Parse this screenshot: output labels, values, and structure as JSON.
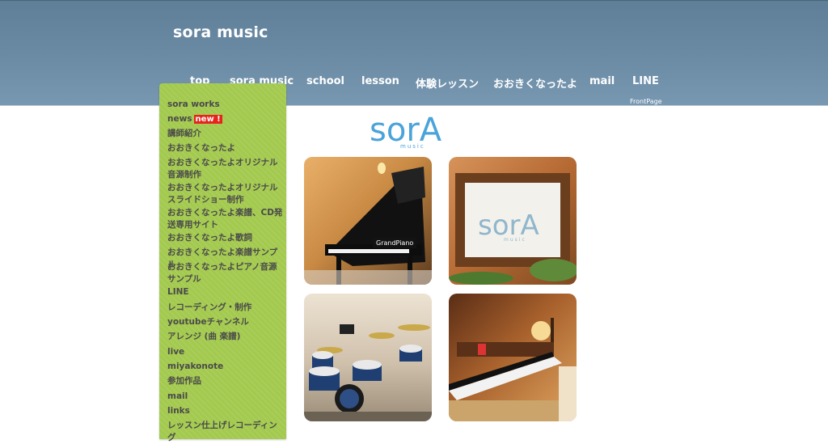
{
  "site": {
    "title": "sora music"
  },
  "nav": {
    "items": [
      {
        "label": "top"
      },
      {
        "label": "sora music"
      },
      {
        "label": "school"
      },
      {
        "label": "lesson"
      },
      {
        "label": "体験レッスン"
      },
      {
        "label": "おおきくなったよ"
      },
      {
        "label": "mail"
      },
      {
        "label": "LINE"
      }
    ],
    "sub_label": "FrontPage"
  },
  "sidebar": {
    "items": [
      {
        "label": "sora works"
      },
      {
        "label": "news"
      },
      {
        "label": "講師紹介"
      },
      {
        "label": "おおきくなったよ"
      },
      {
        "label": "おおきくなったよオリジナル音源制作"
      },
      {
        "label": "おおきくなったよオリジナルスライドショー制作"
      },
      {
        "label": "おおきくなったよ楽譜、CD発送専用サイト"
      },
      {
        "label": "おおきくなったよ歌詞"
      },
      {
        "label": "おおきくなったよ楽譜サンプル"
      },
      {
        "label": "おおきくなったよピアノ音源サンプル"
      },
      {
        "label": "LINE"
      },
      {
        "label": "レコーディング・制作"
      },
      {
        "label": "youtubeチャンネル"
      },
      {
        "label": "アレンジ (曲 楽譜)"
      },
      {
        "label": "live"
      },
      {
        "label": "miyakonote"
      },
      {
        "label": "参加作品"
      },
      {
        "label": "mail"
      },
      {
        "label": "links"
      },
      {
        "label": "レッスン仕上げレコーディング"
      }
    ],
    "new_badge": "new !"
  },
  "logo": {
    "text": "sorA",
    "sub": "music",
    "color": "#4aa3d9"
  },
  "gallery": {
    "photos": [
      {
        "caption": "GrandPiano"
      },
      {
        "logo_text": "sorA",
        "logo_sub": "music"
      },
      {},
      {}
    ]
  },
  "colors": {
    "header": "#6a8aa4",
    "sidebar": "#a3c94e",
    "badge": "#e8231d",
    "logo": "#4aa3d9"
  }
}
